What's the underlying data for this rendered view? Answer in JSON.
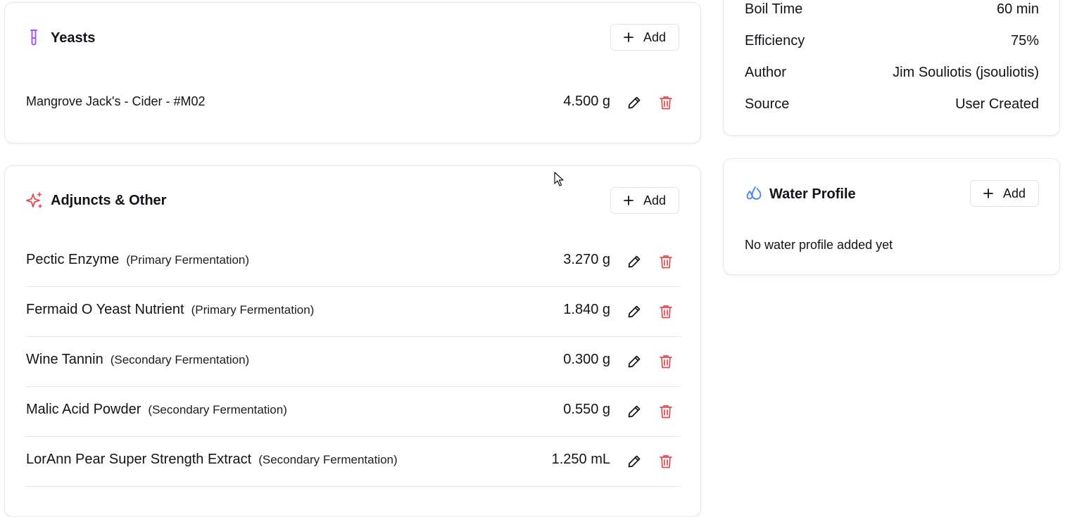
{
  "yeasts": {
    "title": "Yeasts",
    "add_label": "Add",
    "item": {
      "name": "Mangrove Jack's - Cider - #M02",
      "amount": "4.500 g"
    }
  },
  "adjuncts": {
    "title": "Adjuncts & Other",
    "add_label": "Add",
    "items": [
      {
        "name": "Pectic Enzyme",
        "stage": "(Primary Fermentation)",
        "amount": "3.270 g"
      },
      {
        "name": "Fermaid O Yeast Nutrient",
        "stage": "(Primary Fermentation)",
        "amount": "1.840 g"
      },
      {
        "name": "Wine Tannin",
        "stage": "(Secondary Fermentation)",
        "amount": "0.300 g"
      },
      {
        "name": "Malic Acid Powder",
        "stage": "(Secondary Fermentation)",
        "amount": "0.550 g"
      },
      {
        "name": "LorAnn Pear Super Strength Extract",
        "stage": "(Secondary Fermentation)",
        "amount": "1.250 mL"
      }
    ]
  },
  "recipe_info": {
    "rows": [
      {
        "label": "Boil Time",
        "value": "60 min"
      },
      {
        "label": "Efficiency",
        "value": "75%"
      },
      {
        "label": "Author",
        "value": "Jim Souliotis (jsouliotis)"
      },
      {
        "label": "Source",
        "value": "User Created"
      }
    ]
  },
  "water_profile": {
    "title": "Water Profile",
    "add_label": "Add",
    "empty_text": "No water profile added yet"
  },
  "colors": {
    "accent_purple": "#a855f7",
    "accent_red": "#e5484d",
    "accent_blue": "#3b82f6",
    "border": "#e6e8ec"
  }
}
